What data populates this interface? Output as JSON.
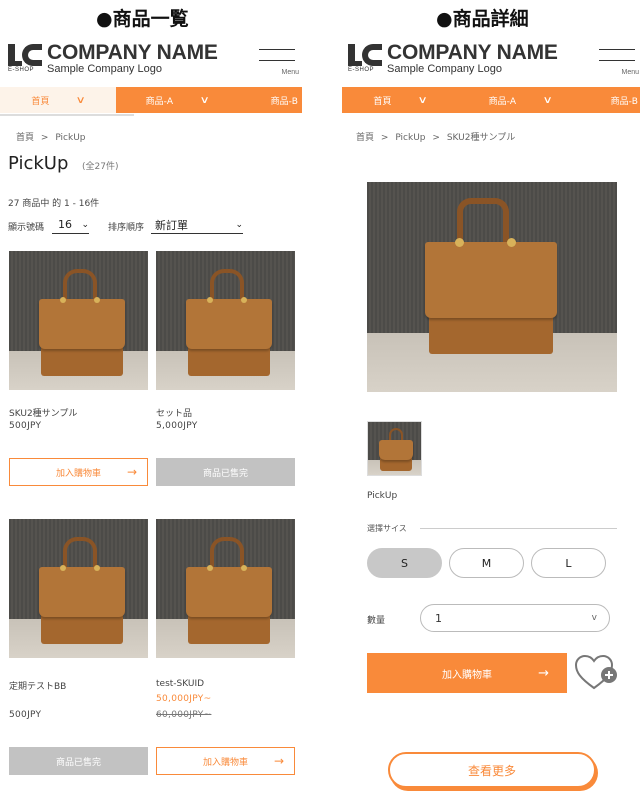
{
  "left": {
    "section_title": "●商品一覧",
    "logo": {
      "name": "COMPANY NAME",
      "sub": "Sample Company Logo",
      "mark_label": "E-SHOP"
    },
    "menu_label": "Menu",
    "nav": [
      "首頁",
      "商品-A",
      "商品-B"
    ],
    "breadcrumb": [
      "首頁",
      ">",
      "PickUp"
    ],
    "page_title": "PickUp",
    "count_label": "(全27件)",
    "result_text": "27 商品中 的 1 - 16件",
    "display_count_label": "顯示號碼",
    "display_count_value": "16",
    "sort_label": "排序順序",
    "sort_value": "新訂單",
    "products": [
      {
        "name": "SKU2種サンプル",
        "price": "500JPY",
        "button": "加入購物車",
        "sold_out": false
      },
      {
        "name": "セット品",
        "price": "5,000JPY",
        "button": "商品已售完",
        "sold_out": true
      },
      {
        "name": "定期テストBB",
        "price": "500JPY",
        "button": "商品已售完",
        "sold_out": true
      },
      {
        "name": "test-SKUID",
        "price": "50,000JPY~",
        "original_price": "60,000JPY~",
        "button": "加入購物車",
        "sold_out": false
      }
    ]
  },
  "right": {
    "section_title": "●商品詳細",
    "logo": {
      "name": "COMPANY NAME",
      "sub": "Sample Company Logo",
      "mark_label": "E-SHOP"
    },
    "menu_label": "Menu",
    "nav": [
      "首頁",
      "商品-A",
      "商品-B"
    ],
    "breadcrumb": [
      "首頁",
      ">",
      "PickUp",
      ">",
      "SKU2種サンプル"
    ],
    "thumb_caption": "PickUp",
    "size_label": "選擇サイス",
    "sizes": [
      "S",
      "M",
      "L"
    ],
    "selected_size": "S",
    "qty_label": "數量",
    "qty_value": "1",
    "add_cart": "加入購物車",
    "more": "查看更多"
  },
  "colors": {
    "accent": "#f98a3a",
    "nav_active_bg": "#fdf3e9",
    "sold_out": "#c2c2c2"
  },
  "icons": {
    "arrow": "→",
    "chevron": "∨",
    "heart": "heart-plus-icon"
  }
}
